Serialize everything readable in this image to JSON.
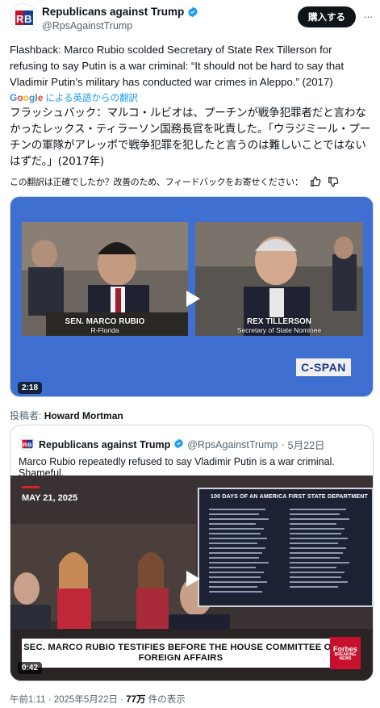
{
  "author": {
    "display_name": "Republicans against Trump",
    "handle": "@RpsAgainstTrump",
    "avatar_text": "RB"
  },
  "buy_button_label": "購入する",
  "more_label": "···",
  "tweet_text": "Flashback: Marco Rubio scolded Secretary of State Rex Tillerson for refusing to say Putin is a war criminal: “It should not be hard to say that Vladimir Putin’s military has conducted war crimes in Aleppo.” (2017)",
  "translation_label": "による英語からの翻訳",
  "translation_logo": [
    "G",
    "o",
    "o",
    "g",
    "l",
    "e"
  ],
  "translated_text": "フラッシュバック：マルコ・ルビオは、プーチンが戦争犯罪者だと言わなかったレックス・ティラーソン国務長官を叱責した。「ウラジミール・プーチンの軍隊がアレッポで戦争犯罪を犯したと言うのは難しいことではないはずだ。」(2017年)",
  "feedback_prompt": "この翻訳は正確でしたか？改善のため、フィードバックをお寄せください：",
  "video1": {
    "left_name": "SEN. MARCO RUBIO",
    "left_sub": "R-Florida",
    "right_name": "REX TILLERSON",
    "right_sub": "Secretary of State Nominee",
    "network_logo": "C-SPAN",
    "duration": "2:18"
  },
  "contributor": {
    "label": "投稿者:",
    "name": "Howard Mortman"
  },
  "quoted": {
    "display_name": "Republicans against Trump",
    "handle": "@RpsAgainstTrump",
    "separator": "·",
    "date": "5月22日",
    "avatar_text": "RB",
    "text": "Marco Rubio repeatedly refused to say Vladimir Putin is a war criminal. Shameful.",
    "video": {
      "date_badge": "MAY 21, 2025",
      "poster_title": "100 DAYS OF AN AMERICA FIRST STATE DEPARTMENT",
      "lower_third": "SEC. MARCO RUBIO TESTIFIES BEFORE THE HOUSE COMMITTEE ON FOREIGN AFFAIRS",
      "forbes_logo": "Forbes",
      "forbes_sub": "BREAKING NEWS",
      "duration": "0:42"
    }
  },
  "footer": {
    "time": "午前1:11 · 2025年5月22日 ·",
    "views": "77万",
    "views_label": "件の表示"
  },
  "colors": {
    "verified": "#1d9bf0",
    "link": "#1d9bf0",
    "video_border": "#3f6fd0",
    "forbes_red": "#c8102e"
  }
}
